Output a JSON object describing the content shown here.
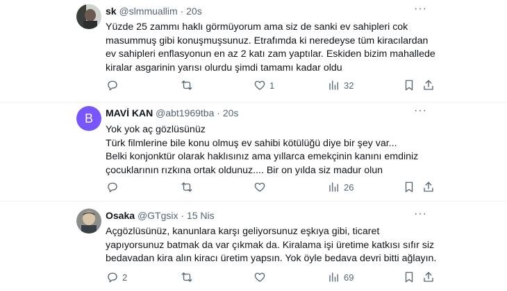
{
  "tweets": [
    {
      "name": "sk",
      "handle": "@slmmuallim",
      "separator": "·",
      "time": "20s",
      "lines": [
        "Yüzde 25 zammı haklı görmüyorum ama siz de sanki ev sahipleri cok",
        "masummuş gibi konuşmuşsunuz. Etrafımda ki neredeyse tüm kiracılardan",
        "ev sahipleri enflasyonun en az 2 katı zam yaptılar. Eskiden bizim mahallede",
        "kiralar asgarinin yarısı olurdu şimdi tamamı kadar oldu"
      ],
      "replies": "",
      "retweets": "",
      "likes": "1",
      "views": "32"
    },
    {
      "name": "MAVİ KAN",
      "handle": "@abt1969tba",
      "separator": "·",
      "time": "20s",
      "avatar_letter": "B",
      "lines": [
        "Yok yok aç gözlüsünüz",
        "Türk filmlerine bile konu olmuş ev sahibi kötülüğü diye bir şey var...",
        "Belki konjonktür olarak haklısınız ama yıllarca emekçinin kanını emdiniz",
        "çocuklarının rızkına ortak oldunuz.... Bir on yılda siz madur olun"
      ],
      "replies": "",
      "retweets": "",
      "likes": "",
      "views": "26"
    },
    {
      "name": "Osaka",
      "handle": "@GTgsix",
      "separator": "·",
      "time": "15 Nis",
      "lines": [
        "Açgözlüsünüz, kanunlara karşı geliyorsunuz eşkıya gibi, ticaret",
        "yapıyorsunuz batmak da var çıkmak da. Kiralama işi üretime katkısı sıfır siz",
        "bedavadan kira alın kiracı üretim yapsın. Yok öyle bedava devri bitti ağlayın."
      ],
      "replies": "2",
      "retweets": "",
      "likes": "",
      "views": "69"
    }
  ],
  "colors": {
    "text": "#0f1419",
    "muted": "#536471",
    "avatar_b": "#7856ff"
  },
  "icons": [
    "reply-icon",
    "retweet-icon",
    "like-icon",
    "views-icon",
    "bookmark-icon",
    "share-icon",
    "more-icon"
  ]
}
